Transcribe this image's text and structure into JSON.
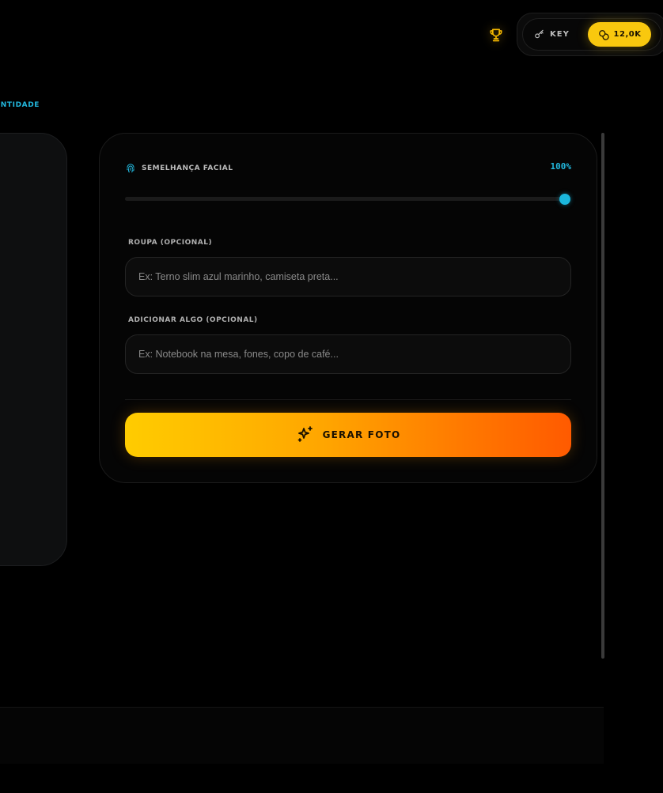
{
  "header": {
    "trophy_icon": "trophy-icon",
    "key_icon": "key-icon",
    "key_label": "KEY",
    "coins_icon": "coins-icon",
    "credits_label": "12,0K"
  },
  "section": {
    "label": "ENTIDADE"
  },
  "similarity": {
    "icon": "fingerprint-icon",
    "label": "SEMELHANÇA FACIAL",
    "value_text": "100%",
    "value": 1.0
  },
  "clothing": {
    "label": "ROUPA (OPCIONAL)",
    "value": "",
    "placeholder": "Ex: Terno slim azul marinho, camiseta preta..."
  },
  "extra": {
    "label": "ADICIONAR ALGO (OPCIONAL)",
    "value": "",
    "placeholder": "Ex: Notebook na mesa, fones, copo de café..."
  },
  "generate": {
    "icon": "sparkles-icon",
    "label": "GERAR FOTO"
  },
  "colors": {
    "accent_cyan": "#22b8de",
    "credits_yellow": "#f9c80e",
    "button_gradient_start": "#ffcc00",
    "button_gradient_end": "#ff5a00",
    "background": "#000000"
  }
}
